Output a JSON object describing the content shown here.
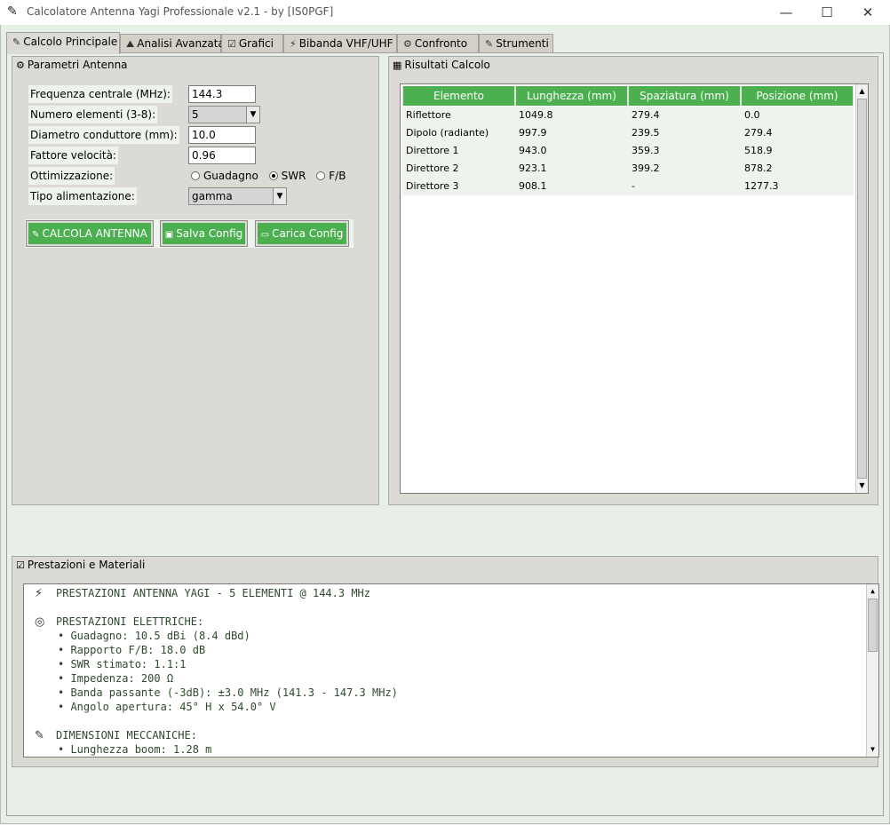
{
  "window": {
    "title": "Calcolatore Antenna Yagi Professionale v2.1 - by [IS0PGF]",
    "minimize": "—",
    "maximize": "☐",
    "close": "✕"
  },
  "tabs": [
    {
      "icon": "⚡",
      "label": "Calcolo Principale",
      "active": true
    },
    {
      "icon": "⚡",
      "label": "Analisi Avanzata"
    },
    {
      "icon": "☑",
      "label": "Grafici"
    },
    {
      "icon": "⚡",
      "label": "Bibanda VHF/UHF"
    },
    {
      "icon": "⚙",
      "label": "Confronto"
    },
    {
      "icon": "⚡",
      "label": "Strumenti"
    }
  ],
  "params": {
    "title": "Parametri Antenna",
    "frequency_label": "Frequenza centrale (MHz):",
    "frequency_value": "144.3",
    "elements_label": "Numero elementi (3-8):",
    "elements_value": "5",
    "diameter_label": "Diametro conduttore (mm):",
    "diameter_value": "10.0",
    "velocity_label": "Fattore velocità:",
    "velocity_value": "0.96",
    "optimization_label": "Ottimizzazione:",
    "opt_gain": "Guadagno",
    "opt_swr": "SWR",
    "opt_fb": "F/B",
    "opt_selected": "SWR",
    "feed_label": "Tipo alimentazione:",
    "feed_value": "gamma",
    "btn_calc": "CALCOLA ANTENNA",
    "btn_save": "Salva Config",
    "btn_load": "Carica Config"
  },
  "results": {
    "title": "Risultati Calcolo",
    "columns": [
      "Elemento",
      "Lunghezza (mm)",
      "Spaziatura (mm)",
      "Posizione (mm)"
    ],
    "rows": [
      [
        "Riflettore",
        "1049.8",
        "279.4",
        "0.0"
      ],
      [
        "Dipolo (radiante)",
        "997.9",
        "239.5",
        "279.4"
      ],
      [
        "Direttore 1",
        "943.0",
        "359.3",
        "518.9"
      ],
      [
        "Direttore 2",
        "923.1",
        "399.2",
        "878.2"
      ],
      [
        "Direttore 3",
        "908.1",
        "-",
        "1277.3"
      ]
    ]
  },
  "performance": {
    "title": "Prestazioni e Materiali",
    "header_line": "PRESTAZIONI ANTENNA YAGI - 5 ELEMENTI @ 144.3 MHz",
    "electric_title": "PRESTAZIONI ELETTRICHE:",
    "electric_items": [
      "• Guadagno: 10.5 dBi (8.4 dBd)",
      "• Rapporto F/B: 18.0 dB",
      "• SWR stimato: 1.1:1",
      "• Impedenza: 200 Ω",
      "• Banda passante (-3dB): ±3.0 MHz (141.3 - 147.3 MHz)",
      "• Angolo apertura: 45° H x 54.0° V"
    ],
    "mech_title": "DIMENSIONI MECCANICHE:",
    "mech_items": [
      "• Lunghezza boom: 1.28 m"
    ]
  }
}
